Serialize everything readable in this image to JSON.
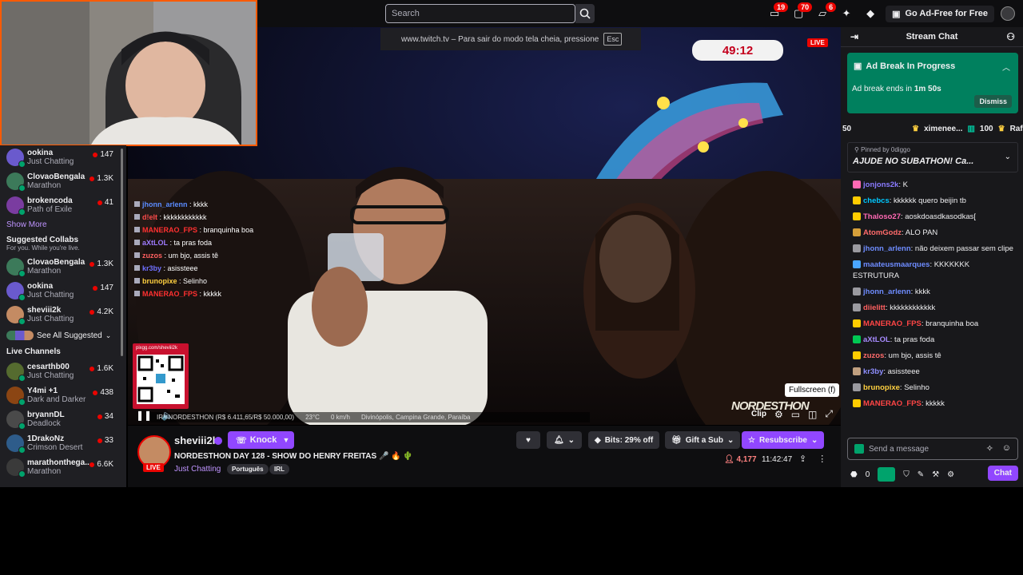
{
  "topbar": {
    "search_placeholder": "Search",
    "badges": [
      "19",
      "70",
      "6"
    ],
    "ad_free_label": "Go Ad-Free for Free"
  },
  "fullscreen_notice": {
    "text": "www.twitch.tv – Para sair do modo tela cheia, pressione",
    "key": "Esc"
  },
  "sidebar": {
    "channels_top": [
      {
        "name": "ookina",
        "cat": "Just Chatting",
        "viewers": "147",
        "color": "#6a5acd"
      },
      {
        "name": "ClovaoBengala",
        "cat": "Marathon",
        "viewers": "1.3K",
        "color": "#3c7a5a"
      },
      {
        "name": "brokencoda",
        "cat": "Path of Exile",
        "viewers": "41",
        "color": "#7a3ca0"
      }
    ],
    "show_more": "Show More",
    "suggested_title": "Suggested Collabs",
    "suggested_sub": "For you. While you're live.",
    "suggested": [
      {
        "name": "ClovaoBengala",
        "cat": "Marathon",
        "viewers": "1.3K",
        "color": "#3c7a5a"
      },
      {
        "name": "ookina",
        "cat": "Just Chatting",
        "viewers": "147",
        "color": "#6a5acd"
      },
      {
        "name": "sheviii2k",
        "cat": "Just Chatting",
        "viewers": "4.2K",
        "color": "#c48b63"
      }
    ],
    "see_all": "See All Suggested",
    "live_title": "Live Channels",
    "live": [
      {
        "name": "cesarthb00",
        "cat": "Just Chatting",
        "viewers": "1.6K",
        "color": "#556b2f"
      },
      {
        "name": "Y4mi +1",
        "cat": "Dark and Darker",
        "viewers": "438",
        "color": "#8b4513"
      },
      {
        "name": "bryannDL",
        "cat": "Deadlock",
        "viewers": "34",
        "color": "#4a4a4a"
      },
      {
        "name": "1DrakoNz",
        "cat": "Crimson Desert",
        "viewers": "33",
        "color": "#2e5c8a"
      },
      {
        "name": "marathonthega...",
        "cat": "Marathon",
        "viewers": "6.6K",
        "color": "#3a3a3a"
      }
    ]
  },
  "video": {
    "timer": "49:12",
    "live_badge": "LIVE",
    "qr_label": "pixgg.com/sheviii2k",
    "ticker": [
      "IRL NORDESTHON (R$ 6.411,65/R$ 50.000,00)",
      "23°C",
      "0 km/h",
      "Divinópolis, Campina Grande, Paraíba"
    ],
    "logo": "NORDESTHON",
    "tooltip": "Fullscreen (f)",
    "clip_label": "Clip",
    "overlay_chat": [
      {
        "user": "jhonn_arlenn",
        "text": " : kkkk",
        "color": "#5b8cff"
      },
      {
        "user": "d!elt",
        "text": " : kkkkkkkkkkkk",
        "color": "#ff4b4b"
      },
      {
        "user": "MANERAO_FPS",
        "text": " : branquinha boa",
        "color": "#ff3030"
      },
      {
        "user": "aXtLOL",
        "text": " : ta pras foda",
        "color": "#9f7bff"
      },
      {
        "user": "zuzos",
        "text": " : um bjo, assis tê",
        "color": "#ff6060"
      },
      {
        "user": "kr3by",
        "text": " : asissteee",
        "color": "#7070ff"
      },
      {
        "user": "brunopixe",
        "text": " : Selinho",
        "color": "#ffd040"
      },
      {
        "user": "MANERAO_FPS",
        "text": " : kkkkk",
        "color": "#ff3030"
      }
    ]
  },
  "channel": {
    "name": "sheviii2k",
    "knock_label": "Knock",
    "live_badge": "LIVE",
    "title": "NORDESTHON DAY 128 - SHOW DO HENRY FREITAS 🎤 🔥 🌵",
    "category": "Just Chatting",
    "tags": [
      "Português",
      "IRL"
    ],
    "bits_label": "Bits: 29% off",
    "gift_label": "Gift a Sub",
    "resub_label": "Resubscribe",
    "viewers": "4,177",
    "uptime": "11:42:47"
  },
  "chat": {
    "header": "Stream Chat",
    "ad_title": "Ad Break In Progress",
    "ad_text_prefix": "Ad break ends in ",
    "ad_time": "1m 50s",
    "dismiss": "Dismiss",
    "giftbar": [
      "50",
      "ximenee...",
      "100",
      "Raffa"
    ],
    "pinned_by": "Pinned by 0diggo",
    "pinned_msg": "AJUDE NO SUBATHON! Ca...",
    "messages": [
      {
        "user": "jonjons2k",
        "text": ": K",
        "color": "#8a7bff"
      },
      {
        "user": "chebcs",
        "text": ": kkkkkk quero beijin tb",
        "color": "#00c8ff"
      },
      {
        "user": "Thaloso27",
        "text": ": aoskdoasdkasodkas[",
        "color": "#ff69b4"
      },
      {
        "user": "AtomGodz",
        "text": ": ALO PAN",
        "color": "#ff6b6b"
      },
      {
        "user": "jhonn_arlenn",
        "text": ": não deixem passar sem clipe",
        "color": "#6e8cff"
      },
      {
        "user": "maateusmaarques",
        "text": ": KKKKKKK ESTRUTURA",
        "color": "#6e8cff"
      },
      {
        "user": "jhonn_arlenn",
        "text": ": kkkk",
        "color": "#6e8cff"
      },
      {
        "user": "diielitt",
        "text": ": kkkkkkkkkkkk",
        "color": "#ff6060"
      },
      {
        "user": "MANERAO_FPS",
        "text": ": branquinha boa",
        "color": "#ff4545"
      },
      {
        "user": "aXtLOL",
        "text": ": ta pras foda",
        "color": "#a78bff"
      },
      {
        "user": "zuzos",
        "text": ": um bjo, assis tê",
        "color": "#ff6b6b"
      },
      {
        "user": "kr3by",
        "text": ": asissteee",
        "color": "#8f8fff"
      },
      {
        "user": "brunopixe",
        "text": ": Selinho",
        "color": "#ffd040"
      },
      {
        "user": "MANERAO_FPS",
        "text": ": kkkkk",
        "color": "#ff4545"
      }
    ],
    "input_placeholder": "Send a message",
    "points": "0",
    "chat_button": "Chat"
  }
}
